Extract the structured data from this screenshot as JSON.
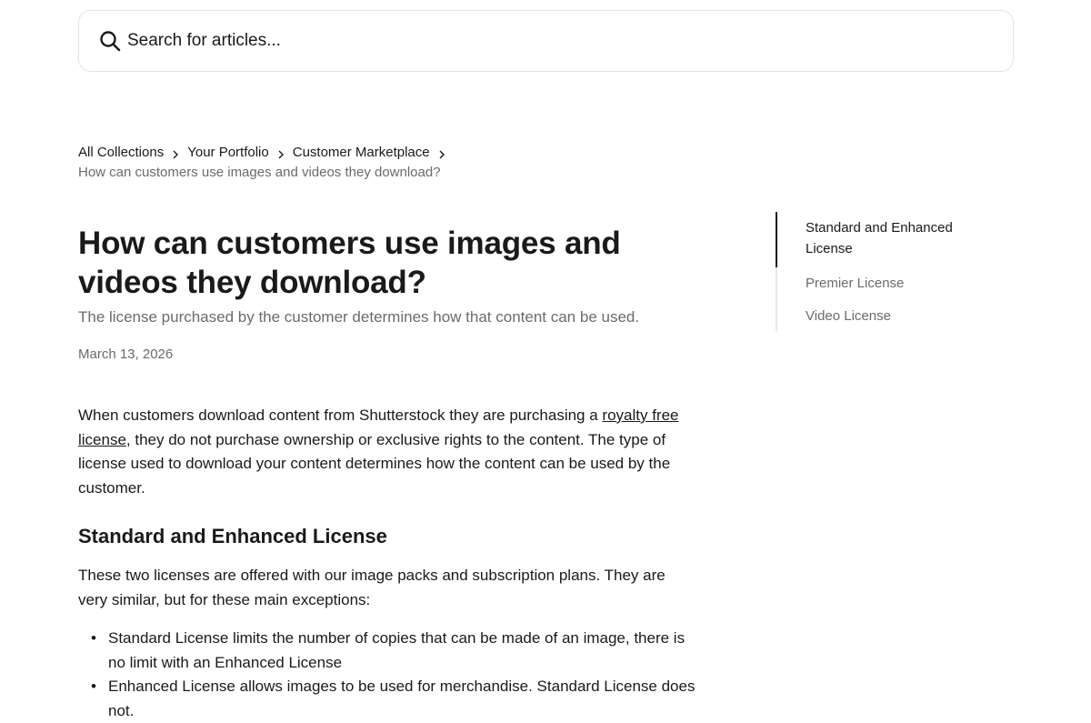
{
  "search": {
    "placeholder": "Search for articles..."
  },
  "breadcrumb": {
    "items": [
      "All Collections",
      "Your Portfolio",
      "Customer Marketplace"
    ],
    "current": "How can customers use images and videos they download?"
  },
  "article": {
    "title": "How can customers use images and videos they download?",
    "subtitle": "The license purchased by the customer determines how that content can be used.",
    "date": "March 13, 2026",
    "intro_before_link": "When customers download content from Shutterstock they are purchasing a ",
    "intro_link": "royalty free license",
    "intro_after_link": ", they do not purchase ownership or exclusive rights to the content. The type of license used to download your content determines how the content can be used by the customer.",
    "section_heading": "Standard and Enhanced License",
    "section_paragraph": "These two licenses are offered with our image packs and subscription plans. They are very similar, but for these main exceptions:",
    "bullets": [
      "Standard License limits the number of copies that can be made of an image, there is no limit with an Enhanced License",
      "Enhanced License allows images to be used for merchandise. Standard License does not."
    ]
  },
  "toc": {
    "items": [
      "Standard and Enhanced License",
      "Premier License",
      "Video License"
    ]
  }
}
